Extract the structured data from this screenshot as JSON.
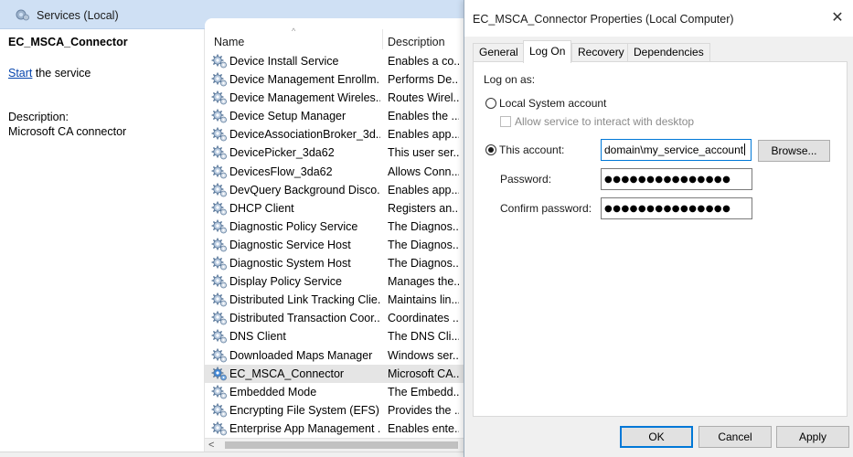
{
  "services": {
    "title": "Services (Local)",
    "selected_name": "EC_MSCA_Connector",
    "start_link": "Start",
    "start_suffix": " the service",
    "description_label": "Description:",
    "description_value": "Microsoft CA connector",
    "columns": {
      "name": "Name",
      "description": "Description"
    },
    "rows": [
      {
        "name": "Device Install Service",
        "desc": "Enables a co...",
        "icon": "gear-icon"
      },
      {
        "name": "Device Management Enrollm...",
        "desc": "Performs De...",
        "icon": "gear-icon"
      },
      {
        "name": "Device Management Wireles...",
        "desc": "Routes Wirel...",
        "icon": "gear-icon"
      },
      {
        "name": "Device Setup Manager",
        "desc": "Enables the ...",
        "icon": "gear-icon"
      },
      {
        "name": "DeviceAssociationBroker_3d...",
        "desc": "Enables app...",
        "icon": "gear-icon"
      },
      {
        "name": "DevicePicker_3da62",
        "desc": "This user ser...",
        "icon": "gear-icon"
      },
      {
        "name": "DevicesFlow_3da62",
        "desc": "Allows Conn...",
        "icon": "gear-icon"
      },
      {
        "name": "DevQuery Background Disco...",
        "desc": "Enables app...",
        "icon": "gear-icon"
      },
      {
        "name": "DHCP Client",
        "desc": "Registers an...",
        "icon": "gear-icon"
      },
      {
        "name": "Diagnostic Policy Service",
        "desc": "The Diagnos...",
        "icon": "gear-icon"
      },
      {
        "name": "Diagnostic Service Host",
        "desc": "The Diagnos...",
        "icon": "gear-icon"
      },
      {
        "name": "Diagnostic System Host",
        "desc": "The Diagnos...",
        "icon": "gear-icon"
      },
      {
        "name": "Display Policy Service",
        "desc": "Manages the...",
        "icon": "gear-icon"
      },
      {
        "name": "Distributed Link Tracking Clie...",
        "desc": "Maintains lin...",
        "icon": "gear-icon"
      },
      {
        "name": "Distributed Transaction Coor...",
        "desc": "Coordinates ...",
        "icon": "gear-icon"
      },
      {
        "name": "DNS Client",
        "desc": "The DNS Cli...",
        "icon": "gear-icon"
      },
      {
        "name": "Downloaded Maps Manager",
        "desc": "Windows ser...",
        "icon": "gear-icon"
      },
      {
        "name": "EC_MSCA_Connector",
        "desc": "Microsoft CA...",
        "icon": "gear-icon",
        "selected": true
      },
      {
        "name": "Embedded Mode",
        "desc": "The Embedd...",
        "icon": "gear-icon"
      },
      {
        "name": "Encrypting File System (EFS)",
        "desc": "Provides the ...",
        "icon": "gear-icon"
      },
      {
        "name": "Enterprise App Management ...",
        "desc": "Enables ente...",
        "icon": "gear-icon"
      }
    ],
    "scroll_left_arrow": "<"
  },
  "dialog": {
    "title": "EC_MSCA_Connector Properties (Local Computer)",
    "close_glyph": "✕",
    "tabs": [
      "General",
      "Log On",
      "Recovery",
      "Dependencies"
    ],
    "active_tab": "Log On",
    "logon": {
      "heading": "Log on as:",
      "local_system_label": "Local System account",
      "interact_desktop_label": "Allow service to interact with desktop",
      "this_account_label": "This account:",
      "account_value": "domain\\my_service_account",
      "browse_label": "Browse...",
      "password_label": "Password:",
      "password_value": "●●●●●●●●●●●●●●●",
      "confirm_label": "Confirm password:",
      "confirm_value": "●●●●●●●●●●●●●●●",
      "selected_option": "This account"
    },
    "buttons": {
      "ok": "OK",
      "cancel": "Cancel",
      "apply": "Apply"
    }
  },
  "colors": {
    "title_bar": "#cfe0f4",
    "link": "#0645ad",
    "focus_border": "#0078d7",
    "selected_row": "#e5e5e5"
  }
}
